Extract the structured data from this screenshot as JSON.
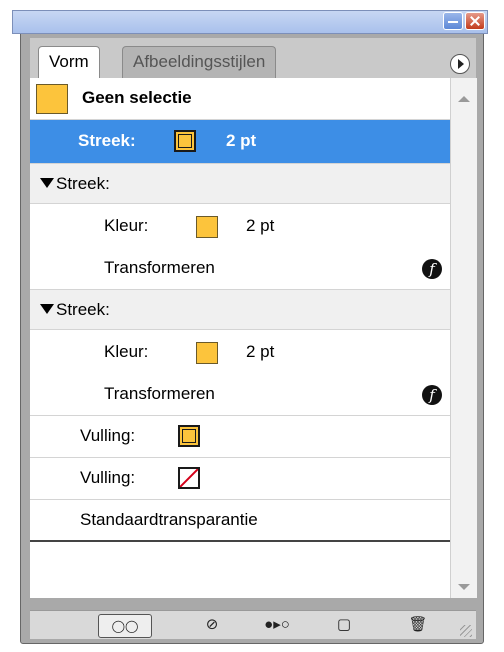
{
  "tabs": {
    "active": "Vorm",
    "inactive": "Afbeeldingsstijlen"
  },
  "header": {
    "label": "Geen selectie"
  },
  "selected_row": {
    "label": "Streek:",
    "value": "2 pt"
  },
  "groups": [
    {
      "header": "Streek:",
      "color_label": "Kleur:",
      "color_value": "2 pt",
      "transform_label": "Transformeren"
    },
    {
      "header": "Streek:",
      "color_label": "Kleur:",
      "color_value": "2 pt",
      "transform_label": "Transformeren"
    }
  ],
  "fills": [
    {
      "label": "Vulling:"
    },
    {
      "label": "Vulling:"
    }
  ],
  "transparency": {
    "label": "Standaardtransparantie"
  },
  "colors": {
    "swatch": "#fcc43c",
    "selection": "#3d8ee6",
    "none_slash": "#d4001a"
  }
}
